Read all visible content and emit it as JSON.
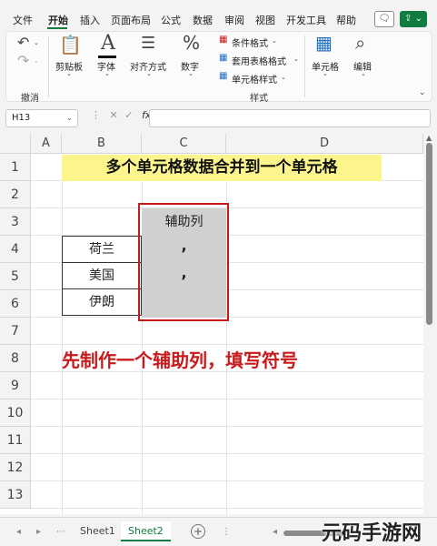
{
  "menu": {
    "items": [
      "文件",
      "开始",
      "插入",
      "页面布局",
      "公式",
      "数据",
      "审阅",
      "视图",
      "开发工具",
      "帮助"
    ],
    "active": "开始"
  },
  "ribbon": {
    "undo_group_label": "撤消",
    "clipboard_label": "剪贴板",
    "font_label": "字体",
    "alignment_label": "对齐方式",
    "number_label": "数字",
    "conditional_format": "条件格式",
    "table_format": "套用表格格式",
    "cell_style": "单元格样式",
    "styles_group_label": "样式",
    "cells_label": "单元格",
    "edit_label": "编辑",
    "icons": [
      "undo-icon",
      "redo-icon",
      "clipboard-icon",
      "font-icon",
      "align-icon",
      "percent-icon",
      "cells-icon",
      "search-icon"
    ]
  },
  "formula_bar": {
    "cell_ref": "H13",
    "fx_label": "fx",
    "formula": ""
  },
  "grid": {
    "columns": [
      "A",
      "B",
      "C",
      "D"
    ],
    "rows": [
      "1",
      "2",
      "3",
      "4",
      "5",
      "6",
      "7",
      "8",
      "9",
      "10",
      "11",
      "12",
      "13"
    ],
    "title": "多个单元格数据合并到一个单元格",
    "helper_header": "辅助列",
    "countries": [
      "荷兰",
      "美国",
      "伊朗"
    ],
    "symbols": [
      ",",
      ","
    ],
    "note": "先制作一个辅助列，填写符号"
  },
  "sheets": {
    "tabs": [
      "Sheet1",
      "Sheet2"
    ],
    "active": "Sheet2"
  },
  "watermark": "元码手游网",
  "colors": {
    "accent": "#107c41",
    "highlight": "#fcf58b",
    "red": "#c8191b",
    "helper_fill": "#d0d0d0"
  }
}
